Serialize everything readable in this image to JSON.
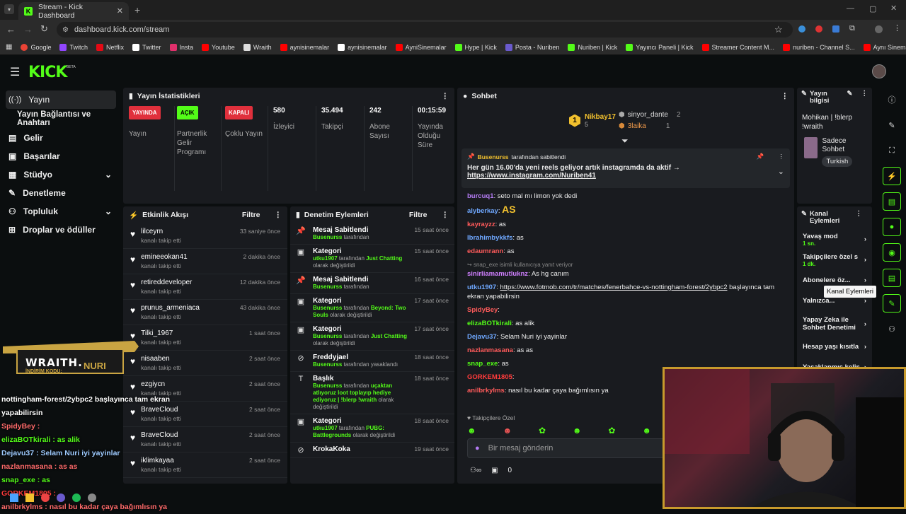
{
  "browser": {
    "tab_title": "Stream - Kick Dashboard",
    "url": "dashboard.kick.com/stream",
    "bookmarks": [
      "Google",
      "Twitch",
      "Netflix",
      "Twitter",
      "Insta",
      "Youtube",
      "Wraith",
      "aynisinemalar",
      "aynisinemalar",
      "AyniSinemalar",
      "Hype | Kick",
      "Posta - Nuriben",
      "Nuriben | Kick",
      "Yayıncı Paneli | Kick",
      "Streamer Content M...",
      "nuriben - Channel S...",
      "Aynı Sinemalar - Ça..."
    ]
  },
  "brand": {
    "logo": "KICK",
    "beta": "BETA",
    "accent": "#53fc18"
  },
  "sidebar": {
    "items": [
      {
        "label": "Yayın",
        "icon": "broadcast-icon"
      },
      {
        "label": "Yayın Bağlantısı ve Anahtarı",
        "icon": ""
      },
      {
        "label": "Gelir",
        "icon": "money-icon"
      },
      {
        "label": "Başarılar",
        "icon": "trophy-icon"
      },
      {
        "label": "Stüdyo",
        "icon": "studio-icon"
      },
      {
        "label": "Denetleme",
        "icon": "wrench-icon"
      },
      {
        "label": "Topluluk",
        "icon": "community-icon"
      },
      {
        "label": "Droplar ve ödüller",
        "icon": "gift-icon"
      }
    ]
  },
  "stats": {
    "title": "Yayın İstatistikleri",
    "items": [
      {
        "badge": "YAYINDA",
        "label": "Yayın"
      },
      {
        "badge": "AÇIK",
        "label": "Partnerlik Gelir Programı"
      },
      {
        "badge": "KAPALI",
        "label": "Çoklu Yayın"
      },
      {
        "value": "580",
        "label": "İzleyici"
      },
      {
        "value": "35.494",
        "label": "Takipçi"
      },
      {
        "value": "242",
        "label": "Abone Sayısı"
      },
      {
        "value": "00:15:59",
        "label": "Yayında Olduğu Süre"
      }
    ]
  },
  "activity": {
    "title": "Etkinlik Akışı",
    "filter": "Filtre",
    "rows": [
      {
        "name": "lilceyrn",
        "sub": "kanalı takip etti",
        "time": "33 saniye önce"
      },
      {
        "name": "emineeokan41",
        "sub": "kanalı takip etti",
        "time": "2 dakika önce"
      },
      {
        "name": "retireddeveloper",
        "sub": "kanalı takip etti",
        "time": "12 dakika önce"
      },
      {
        "name": "prunus_armeniaca",
        "sub": "kanalı takip etti",
        "time": "43 dakika önce"
      },
      {
        "name": "Tilki_1967",
        "sub": "kanalı takip etti",
        "time": "1 saat önce"
      },
      {
        "name": "nisaaben",
        "sub": "kanalı takip etti",
        "time": "2 saat önce"
      },
      {
        "name": "ezgiycn",
        "sub": "kanalı takip etti",
        "time": "2 saat önce"
      },
      {
        "name": "BraveCloud",
        "sub": "kanalı takip etti",
        "time": "2 saat önce"
      },
      {
        "name": "BraveCloud",
        "sub": "kanalı takip etti",
        "time": "2 saat önce"
      },
      {
        "name": "iklimkayaa",
        "sub": "kanalı takip etti",
        "time": "2 saat önce"
      }
    ]
  },
  "moderation": {
    "title": "Denetim Eylemleri",
    "filter": "Filtre",
    "rows": [
      {
        "icon": "pin-icon",
        "title": "Mesaj Sabitlendi",
        "user": "Busenurss",
        "mid": " tarafından",
        "tail": "",
        "time": "15 saat önce"
      },
      {
        "icon": "category-icon",
        "title": "Kategori",
        "user": "utku1907",
        "mid": " tarafından ",
        "cat": "Just Chatting",
        "tail": " olarak değiştirildi",
        "time": "15 saat önce"
      },
      {
        "icon": "pin-icon",
        "title": "Mesaj Sabitlendi",
        "user": "Busenurss",
        "mid": " tarafından",
        "tail": "",
        "time": "16 saat önce"
      },
      {
        "icon": "category-icon",
        "title": "Kategori",
        "user": "Busenurss",
        "mid": " tarafından ",
        "cat": "Beyond: Two Souls",
        "tail": " olarak değiştirildi",
        "time": "17 saat önce"
      },
      {
        "icon": "category-icon",
        "title": "Kategori",
        "user": "Busenurss",
        "mid": " tarafından ",
        "cat": "Just Chatting",
        "tail": " olarak değiştirildi",
        "time": "17 saat önce"
      },
      {
        "icon": "ban-icon",
        "title": "Freddyjael",
        "user": "Busenurss",
        "mid": " tarafından yasaklandı",
        "tail": "",
        "time": "18 saat önce"
      },
      {
        "icon": "title-icon",
        "title": "Başlık",
        "user": "Busenurss",
        "mid": " tarafından ",
        "cat": "uçaktan atlıyoruz loot toplayıp hediye ediyoruz | !blerp !wraith",
        "tail": " olarak değiştirildi",
        "time": "18 saat önce"
      },
      {
        "icon": "category-icon",
        "title": "Kategori",
        "user": "utku1907",
        "mid": " tarafından ",
        "cat": "PUBG: Battlegrounds",
        "tail": " olarak değiştirildi",
        "time": "18 saat önce"
      },
      {
        "icon": "ban-icon",
        "title": "KrokaKoka",
        "user": "",
        "mid": "",
        "tail": "",
        "time": "19 saat önce"
      }
    ]
  },
  "chat": {
    "title": "Sohbet",
    "leaders": [
      {
        "rank": "1",
        "name": "Nikbay17",
        "count": "5"
      },
      {
        "name": "sinyor_dante",
        "count": "2"
      },
      {
        "name": "3laika",
        "count": "1"
      }
    ],
    "pinned": {
      "by_user": "Busenurss",
      "by_text": " tarafından sabitlendi",
      "text": "Her gün 16.00'da yeni reels geliyor artık instagramda da aktif →",
      "link": "https://www.instagram.com/Nuriben41"
    },
    "messages": [
      {
        "user": "burcuq1",
        "color": "#b57cf5",
        "text": ": seto mal mı limon yok dedi"
      },
      {
        "user": "alyberkay",
        "color": "#6fa8ff",
        "text": ":",
        "emote": "AS"
      },
      {
        "user": "kayrayzz",
        "color": "#ff5b5b",
        "text": ": as"
      },
      {
        "user": "Ibrahimbykkfs",
        "color": "#6fa8ff",
        "text": ": as"
      },
      {
        "user": "edaumrann",
        "color": "#ff5b5b",
        "text": ": as"
      },
      {
        "reply_user": "snap_exe",
        "reply_text": "isimli kullanıcıya yanıt veriyor",
        "user": "sinirliamamutluknz",
        "color": "#d080ff",
        "text": ": As hg canım"
      },
      {
        "user": "utku1907",
        "color": "#6fa8ff",
        "text": ": ",
        "link": "https://www.fotmob.com/tr/matches/fenerbahce-vs-nottingham-forest/2ybpc2",
        "tail": " başlayınca tam ekran yapabilirsin"
      },
      {
        "user": "SpidyBey",
        "color": "#ff5b5b",
        "text": ":"
      },
      {
        "user": "elizaBOTkirali",
        "color": "#53fc18",
        "text": ": as alik"
      },
      {
        "user": "Dejavu37",
        "color": "#6fa8ff",
        "text": ": Selam Nuri iyi yayinlar"
      },
      {
        "user": "nazlanmasana",
        "color": "#ff5b5b",
        "text": ": as as"
      },
      {
        "user": "snap_exe",
        "color": "#53fc18",
        "text": ": as"
      },
      {
        "user": "GORKEM1805",
        "color": "#ff3b3b",
        "text": ":"
      },
      {
        "user": "anilbrkylms",
        "color": "#ff5b5b",
        "text": ": nasıl bu kadar çaya bağımlısın ya"
      }
    ],
    "followers_only": "Takipçilere Özel",
    "input_placeholder": "Bir mesaj gönderin",
    "count": "0"
  },
  "stream_info": {
    "title": "Yayın bilgisi",
    "stream_title": "Mohikan | !blerp !wraith",
    "category": "Sadece Sohbet",
    "language": "Turkish"
  },
  "channel_actions": {
    "title": "Kanal Eylemleri",
    "items": [
      {
        "label": "Yavaş mod",
        "sub": "1 sn."
      },
      {
        "label": "Takipçilere özel s",
        "sub": "1 dk."
      },
      {
        "label": "Abonelere öz...",
        "sub": ""
      },
      {
        "label": "Yalnızca...",
        "sub": ""
      },
      {
        "label": "Yapay Zeka ile Sohbet Denetimi",
        "sub": ""
      },
      {
        "label": "Hesap yaşı kısıtla",
        "sub": ""
      },
      {
        "label": "Yasaklanmış kelin",
        "sub": ""
      }
    ],
    "tooltip": "Kanal Eylemleri"
  },
  "overlay": {
    "promo": "WRAITH.",
    "promo_code_label": "İNDİRİM KODU:",
    "promo_code": "NURI",
    "lines": [
      "nottingham-forest/2ybpc2 başlayınca tam ekran",
      "yapabilirsin",
      "SpidyBey :",
      "elizaBOTkirali : as alik",
      "Dejavu37 : Selam Nuri iyi yayinlar",
      "nazlanmasana : as as",
      "snap_exe : as",
      "GORKEM1805 :",
      "anilbrkylms : nasıl bu kadar çaya bağımlısın ya"
    ]
  }
}
